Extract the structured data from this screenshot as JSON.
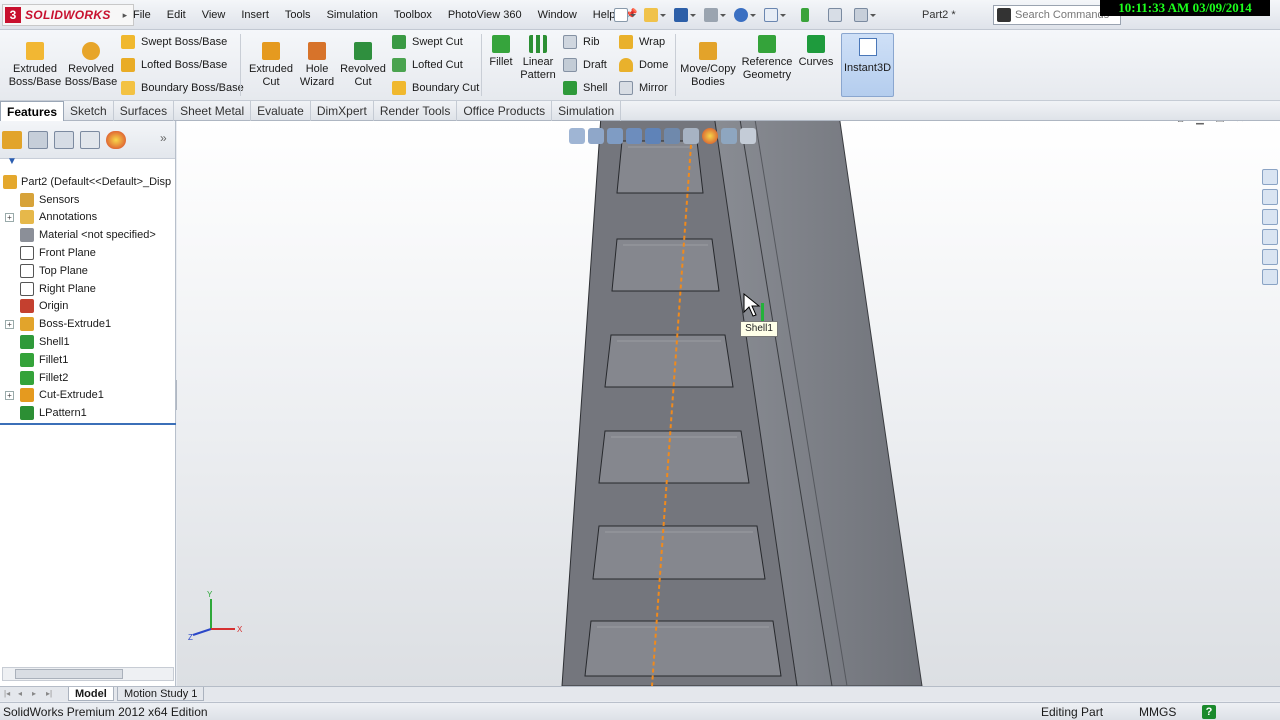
{
  "app": {
    "name": "SOLIDWORKS",
    "document": "Part2 *",
    "search_placeholder": "Search Commands",
    "clock": "10:11:33 AM 03/09/2014"
  },
  "menu": [
    "File",
    "Edit",
    "View",
    "Insert",
    "Tools",
    "Simulation",
    "Toolbox",
    "PhotoView 360",
    "Window",
    "Help"
  ],
  "command_manager": {
    "extruded_boss": "Extruded Boss/Base",
    "revolved_boss": "Revolved Boss/Base",
    "swept_boss": "Swept Boss/Base",
    "lofted_boss": "Lofted Boss/Base",
    "boundary_boss": "Boundary Boss/Base",
    "extruded_cut": "Extruded Cut",
    "hole_wizard": "Hole Wizard",
    "revolved_cut": "Revolved Cut",
    "swept_cut": "Swept Cut",
    "lofted_cut": "Lofted Cut",
    "boundary_cut": "Boundary Cut",
    "fillet": "Fillet",
    "linear_pattern": "Linear Pattern",
    "rib": "Rib",
    "draft": "Draft",
    "shell": "Shell",
    "wrap": "Wrap",
    "dome": "Dome",
    "mirror": "Mirror",
    "move_copy": "Move/Copy Bodies",
    "ref_geometry": "Reference Geometry",
    "curves": "Curves",
    "instant3d": "Instant3D"
  },
  "tabs": [
    "Features",
    "Sketch",
    "Surfaces",
    "Sheet Metal",
    "Evaluate",
    "DimXpert",
    "Render Tools",
    "Office Products",
    "Simulation"
  ],
  "feature_tree": {
    "root": "Part2  (Default<<Default>_Disp",
    "items": [
      {
        "label": "Sensors",
        "icon": "sensor-icon",
        "expandable": false
      },
      {
        "label": "Annotations",
        "icon": "annotation-icon",
        "expandable": true
      },
      {
        "label": "Material <not specified>",
        "icon": "material-icon",
        "expandable": false
      },
      {
        "label": "Front Plane",
        "icon": "plane-icon",
        "expandable": false
      },
      {
        "label": "Top Plane",
        "icon": "plane-icon",
        "expandable": false
      },
      {
        "label": "Right Plane",
        "icon": "plane-icon",
        "expandable": false
      },
      {
        "label": "Origin",
        "icon": "origin-icon",
        "expandable": false
      },
      {
        "label": "Boss-Extrude1",
        "icon": "extrude-icon",
        "expandable": true
      },
      {
        "label": "Shell1",
        "icon": "shell-icon",
        "expandable": false
      },
      {
        "label": "Fillet1",
        "icon": "fillet-icon",
        "expandable": false
      },
      {
        "label": "Fillet2",
        "icon": "fillet-icon",
        "expandable": false
      },
      {
        "label": "Cut-Extrude1",
        "icon": "cut-extrude-icon",
        "expandable": true
      },
      {
        "label": "LPattern1",
        "icon": "linear-pattern-icon",
        "expandable": false
      }
    ]
  },
  "viewport": {
    "tooltip": "Shell1",
    "triad": {
      "x": "X",
      "y": "Y",
      "z": "Z"
    }
  },
  "bottom_tabs": [
    "Model",
    "Motion Study 1"
  ],
  "status": {
    "edition": "SolidWorks Premium 2012 x64 Edition",
    "mode": "Editing Part",
    "units": "MMGS",
    "help": "?"
  },
  "colors": {
    "brand": "#c8102e",
    "active_button": "#b4cdee",
    "model_face": "#7e8088",
    "pattern_line": "#f08a1c"
  }
}
